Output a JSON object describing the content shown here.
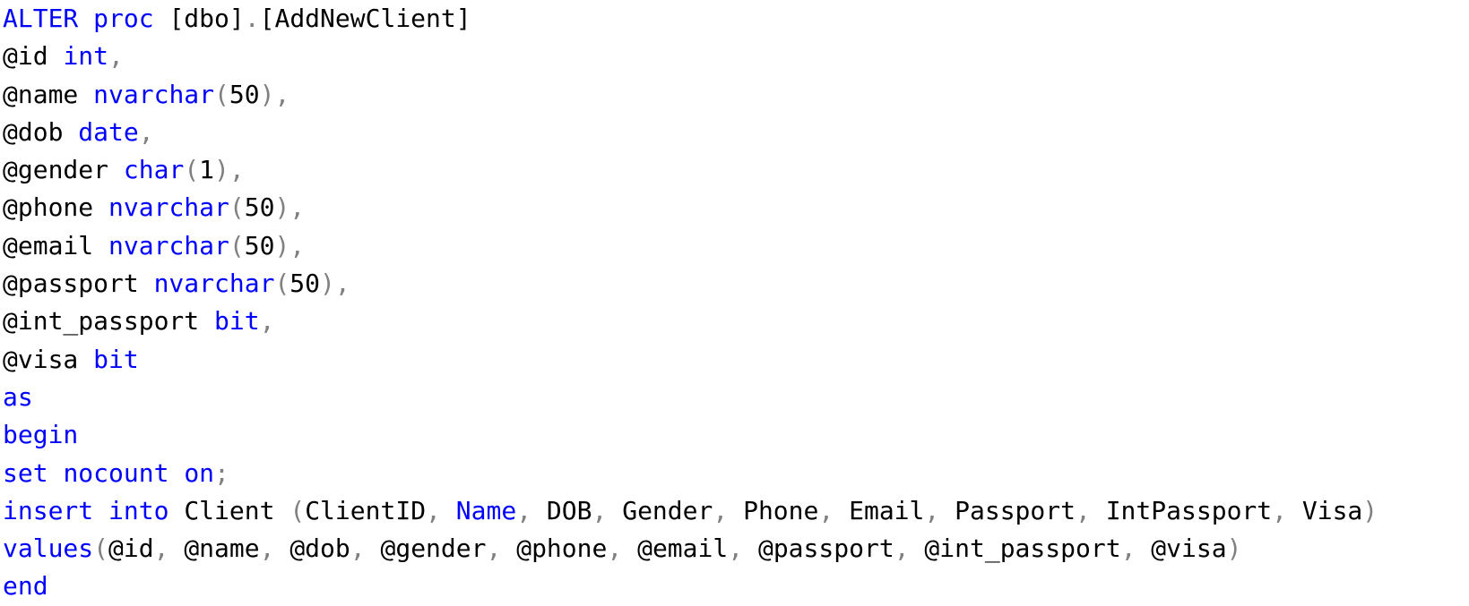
{
  "editor": {
    "language": "T-SQL",
    "colors": {
      "keyword": "#0000ff",
      "operator": "#808080",
      "identifier": "#000000",
      "background": "#ffffff"
    },
    "lines": [
      [
        {
          "t": "ALTER",
          "k": "kw"
        },
        {
          "t": " ",
          "k": "plain"
        },
        {
          "t": "proc",
          "k": "kw"
        },
        {
          "t": " ",
          "k": "plain"
        },
        {
          "t": "[dbo]",
          "k": "plain"
        },
        {
          "t": ".",
          "k": "op"
        },
        {
          "t": "[AddNewClient]",
          "k": "plain"
        }
      ],
      [
        {
          "t": "@id",
          "k": "plain"
        },
        {
          "t": " ",
          "k": "plain"
        },
        {
          "t": "int",
          "k": "kw"
        },
        {
          "t": ",",
          "k": "op"
        }
      ],
      [
        {
          "t": "@name",
          "k": "plain"
        },
        {
          "t": " ",
          "k": "plain"
        },
        {
          "t": "nvarchar",
          "k": "kw"
        },
        {
          "t": "(",
          "k": "op"
        },
        {
          "t": "50",
          "k": "plain"
        },
        {
          "t": "),",
          "k": "op"
        }
      ],
      [
        {
          "t": "@dob",
          "k": "plain"
        },
        {
          "t": " ",
          "k": "plain"
        },
        {
          "t": "date",
          "k": "kw"
        },
        {
          "t": ",",
          "k": "op"
        }
      ],
      [
        {
          "t": "@gender",
          "k": "plain"
        },
        {
          "t": " ",
          "k": "plain"
        },
        {
          "t": "char",
          "k": "kw"
        },
        {
          "t": "(",
          "k": "op"
        },
        {
          "t": "1",
          "k": "plain"
        },
        {
          "t": "),",
          "k": "op"
        }
      ],
      [
        {
          "t": "@phone",
          "k": "plain"
        },
        {
          "t": " ",
          "k": "plain"
        },
        {
          "t": "nvarchar",
          "k": "kw"
        },
        {
          "t": "(",
          "k": "op"
        },
        {
          "t": "50",
          "k": "plain"
        },
        {
          "t": "),",
          "k": "op"
        }
      ],
      [
        {
          "t": "@email",
          "k": "plain"
        },
        {
          "t": " ",
          "k": "plain"
        },
        {
          "t": "nvarchar",
          "k": "kw"
        },
        {
          "t": "(",
          "k": "op"
        },
        {
          "t": "50",
          "k": "plain"
        },
        {
          "t": "),",
          "k": "op"
        }
      ],
      [
        {
          "t": "@passport",
          "k": "plain"
        },
        {
          "t": " ",
          "k": "plain"
        },
        {
          "t": "nvarchar",
          "k": "kw"
        },
        {
          "t": "(",
          "k": "op"
        },
        {
          "t": "50",
          "k": "plain"
        },
        {
          "t": "),",
          "k": "op"
        }
      ],
      [
        {
          "t": "@int_passport",
          "k": "plain"
        },
        {
          "t": " ",
          "k": "plain"
        },
        {
          "t": "bit",
          "k": "kw"
        },
        {
          "t": ",",
          "k": "op"
        }
      ],
      [
        {
          "t": "@visa",
          "k": "plain"
        },
        {
          "t": " ",
          "k": "plain"
        },
        {
          "t": "bit",
          "k": "kw"
        }
      ],
      [
        {
          "t": "as",
          "k": "kw"
        }
      ],
      [
        {
          "t": "begin",
          "k": "kw"
        }
      ],
      [
        {
          "t": "set",
          "k": "kw"
        },
        {
          "t": " ",
          "k": "plain"
        },
        {
          "t": "nocount",
          "k": "kw"
        },
        {
          "t": " ",
          "k": "plain"
        },
        {
          "t": "on",
          "k": "kw"
        },
        {
          "t": ";",
          "k": "op"
        }
      ],
      [
        {
          "t": "insert",
          "k": "kw"
        },
        {
          "t": " ",
          "k": "plain"
        },
        {
          "t": "into",
          "k": "kw"
        },
        {
          "t": " ",
          "k": "plain"
        },
        {
          "t": "Client",
          "k": "plain"
        },
        {
          "t": " ",
          "k": "plain"
        },
        {
          "t": "(",
          "k": "op"
        },
        {
          "t": "ClientID",
          "k": "plain"
        },
        {
          "t": ", ",
          "k": "op"
        },
        {
          "t": "Name",
          "k": "kw"
        },
        {
          "t": ", ",
          "k": "op"
        },
        {
          "t": "DOB",
          "k": "plain"
        },
        {
          "t": ", ",
          "k": "op"
        },
        {
          "t": "Gender",
          "k": "plain"
        },
        {
          "t": ", ",
          "k": "op"
        },
        {
          "t": "Phone",
          "k": "plain"
        },
        {
          "t": ", ",
          "k": "op"
        },
        {
          "t": "Email",
          "k": "plain"
        },
        {
          "t": ", ",
          "k": "op"
        },
        {
          "t": "Passport",
          "k": "plain"
        },
        {
          "t": ", ",
          "k": "op"
        },
        {
          "t": "IntPassport",
          "k": "plain"
        },
        {
          "t": ", ",
          "k": "op"
        },
        {
          "t": "Visa",
          "k": "plain"
        },
        {
          "t": ")",
          "k": "op"
        }
      ],
      [
        {
          "t": "values",
          "k": "kw"
        },
        {
          "t": "(",
          "k": "op"
        },
        {
          "t": "@id",
          "k": "plain"
        },
        {
          "t": ", ",
          "k": "op"
        },
        {
          "t": "@name",
          "k": "plain"
        },
        {
          "t": ", ",
          "k": "op"
        },
        {
          "t": "@dob",
          "k": "plain"
        },
        {
          "t": ", ",
          "k": "op"
        },
        {
          "t": "@gender",
          "k": "plain"
        },
        {
          "t": ", ",
          "k": "op"
        },
        {
          "t": "@phone",
          "k": "plain"
        },
        {
          "t": ", ",
          "k": "op"
        },
        {
          "t": "@email",
          "k": "plain"
        },
        {
          "t": ", ",
          "k": "op"
        },
        {
          "t": "@passport",
          "k": "plain"
        },
        {
          "t": ", ",
          "k": "op"
        },
        {
          "t": "@int_passport",
          "k": "plain"
        },
        {
          "t": ", ",
          "k": "op"
        },
        {
          "t": "@visa",
          "k": "plain"
        },
        {
          "t": ")",
          "k": "op"
        }
      ],
      [
        {
          "t": "end",
          "k": "kw"
        }
      ]
    ]
  }
}
